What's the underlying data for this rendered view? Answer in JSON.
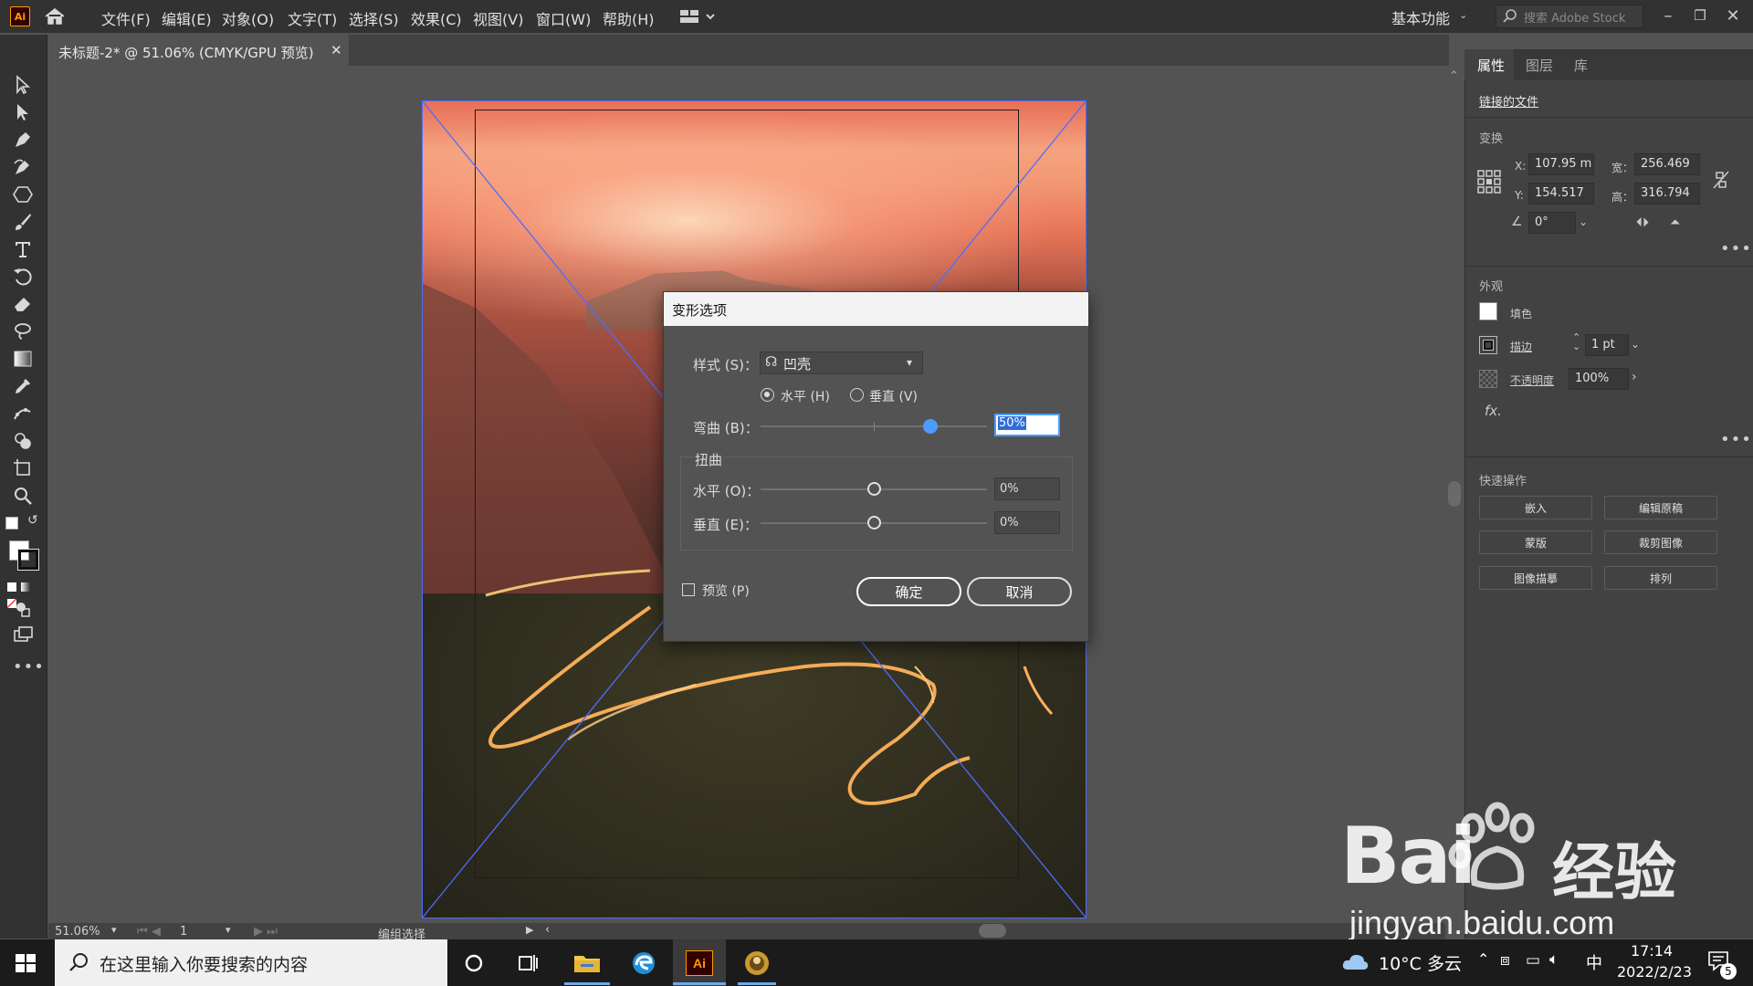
{
  "app": {
    "logo": "Ai",
    "menus": [
      "文件(F)",
      "编辑(E)",
      "对象(O)",
      "文字(T)",
      "选择(S)",
      "效果(C)",
      "视图(V)",
      "窗口(W)",
      "帮助(H)"
    ],
    "workspace": "基本功能",
    "stock_search_placeholder": "搜索 Adobe Stock"
  },
  "document": {
    "tab_title": "未标题-2* @ 51.06% (CMYK/GPU 预览)",
    "close_glyph": "✕"
  },
  "dialog": {
    "title": "变形选项",
    "style_label": "样式 (S)：",
    "style_value": "凹壳",
    "horizontal_label": "水平 (H)",
    "vertical_label": "垂直 (V)",
    "orientation_selected": "horizontal",
    "bend_label": "弯曲 (B)：",
    "bend_value": "50%",
    "bend_fraction": 0.75,
    "distortion_label": "扭曲",
    "distort_h_label": "水平 (O)：",
    "distort_h_value": "0%",
    "distort_v_label": "垂直 (E)：",
    "distort_v_value": "0%",
    "preview_label": "预览 (P)",
    "preview_checked": false,
    "ok_label": "确定",
    "cancel_label": "取消"
  },
  "status": {
    "zoom": "51.06%",
    "page": "1",
    "mode": "编组选择"
  },
  "panel": {
    "tabs": [
      "属性",
      "图层",
      "库"
    ],
    "linked_file": "链接的文件",
    "transform_title": "变换",
    "x_label": "X:",
    "x_value": "107.95 m",
    "y_label": "Y:",
    "y_value": "154.517",
    "w_label": "宽：",
    "w_value": "256.469",
    "h_label": "高：",
    "h_value": "316.794",
    "angle_value": "0°",
    "appearance_title": "外观",
    "fill_label": "填色",
    "stroke_label": "描边",
    "stroke_value": "1 pt",
    "opacity_label": "不透明度",
    "opacity_value": "100%",
    "fx_label": "fx.",
    "quick_actions_title": "快速操作",
    "buttons": [
      "嵌入",
      "编辑原稿",
      "蒙版",
      "裁剪图像",
      "图像描摹",
      "排列"
    ]
  },
  "taskbar": {
    "search_placeholder": "在这里输入你要搜索的内容",
    "weather": "10°C 多云",
    "ime": "中",
    "time": "17:14",
    "date": "2022/2/23",
    "notifications": "5",
    "ai_label": "Ai"
  },
  "watermark": {
    "brand": "Bai",
    "brand_cn": "经验",
    "url": "jingyan.baidu.com"
  },
  "colors": {
    "accent_blue": "#4b9cff",
    "envelope_blue": "#4f6cff",
    "ai_orange": "#ff9a00"
  }
}
